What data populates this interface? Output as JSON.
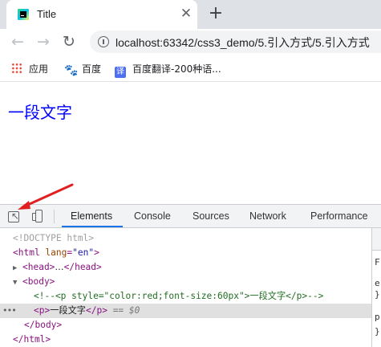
{
  "tab": {
    "title": "Title",
    "close_glyph": "✕",
    "newtab_glyph": "+"
  },
  "toolbar": {
    "back_glyph": "←",
    "forward_glyph": "→",
    "reload_glyph": "↻",
    "url": "localhost:63342/css3_demo/5.引入方式/5.引入方式"
  },
  "bookmarks": [
    {
      "label": "应用",
      "icon": "apps-icon"
    },
    {
      "label": "百度",
      "icon": "baidu-paw-icon"
    },
    {
      "label": "百度翻译-200种语...",
      "icon": "baidu-translate-icon"
    }
  ],
  "page": {
    "text": "一段文字"
  },
  "devtools": {
    "tabs": [
      "Elements",
      "Console",
      "Sources",
      "Network",
      "Performance"
    ],
    "active_tab": "Elements",
    "arrow_color": "#e02020",
    "lines": {
      "doctype": "<!DOCTYPE html>",
      "html_open_tag": "<html",
      "html_attr": "lang",
      "html_attr_val": "\"en\"",
      "html_close_bracket": ">",
      "head": "<head>",
      "head_ellipsis": "…",
      "head_close": "</head>",
      "body_open": "<body>",
      "comment": "<!--<p style=\"color:red;font-size:60px\">一段文字</p>-->",
      "p_open": "<p>",
      "p_text": "一段文字",
      "p_close": "</p>",
      "sel_marker": "== $0",
      "body_close": "</body>",
      "html_close": "</html>"
    },
    "side": [
      "F",
      "e",
      "}",
      "p",
      "}"
    ]
  }
}
